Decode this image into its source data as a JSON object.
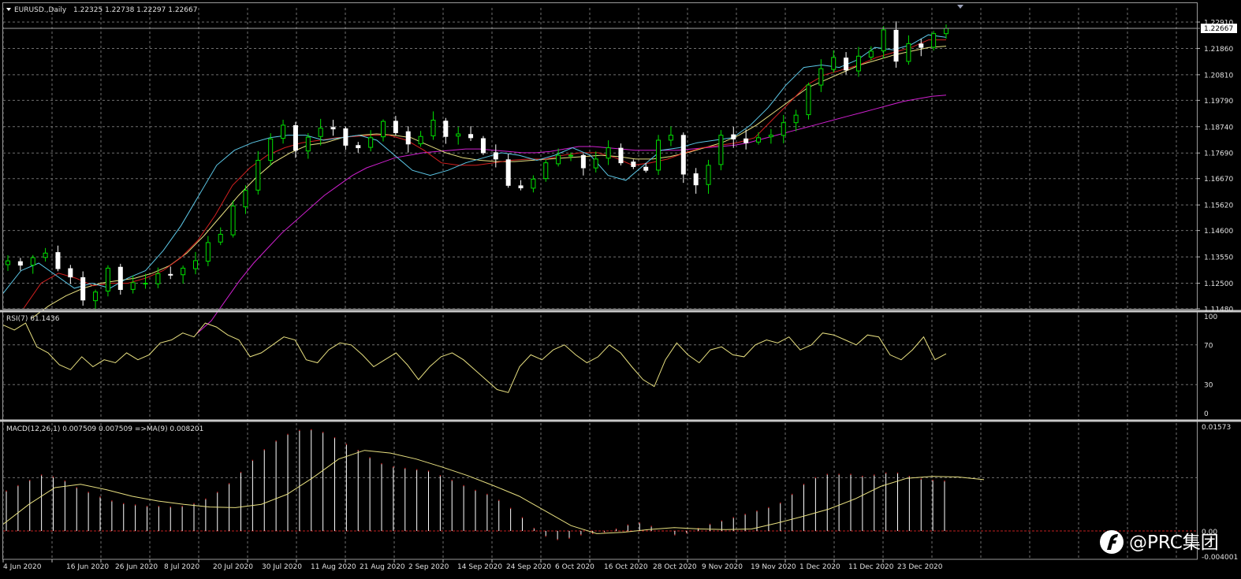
{
  "header": {
    "symbol": "EURUSD.,Daily",
    "ohlc": "1.22325 1.22738 1.22297 1.22667"
  },
  "price_tag": "1.22667",
  "rsi_label": "RSI(7) 61.1436",
  "macd_label": "MACD(12,26,1) 0.007509 0.007509 =>MA(9) 0.008201",
  "watermark": "@PRC集团",
  "colors": {
    "background": "#000000",
    "grid": "#6f6f6f",
    "bull_candle": "#00e000",
    "bear_candle": "#ffffff",
    "ma_fast": "#5cc8e8",
    "ma_mid": "#d42020",
    "ma_slow": "#e8e080",
    "ma_long": "#d020d0",
    "rsi_line": "#e8e080",
    "macd_hist": "#ffffff",
    "macd_signal": "#e8e080",
    "zero_line": "#c02020"
  },
  "chart_data": [
    {
      "type": "candlestick",
      "title": "EURUSD.,Daily",
      "ylim": [
        1.1148,
        1.2291
      ],
      "y_ticks": [
        "1.22910",
        "1.21860",
        "1.20810",
        "1.19790",
        "1.18740",
        "1.17690",
        "1.16670",
        "1.15620",
        "1.14600",
        "1.13550",
        "1.12500",
        "1.11480"
      ],
      "x_ticks": [
        "4 Jun 2020",
        "16 Jun 2020",
        "26 Jun 2020",
        "8 Jul 2020",
        "20 Jul 2020",
        "30 Jul 2020",
        "11 Aug 2020",
        "21 Aug 2020",
        "2 Sep 2020",
        "14 Sep 2020",
        "24 Sep 2020",
        "6 Oct 2020",
        "16 Oct 2020",
        "28 Oct 2020",
        "9 Nov 2020",
        "19 Nov 2020",
        "1 Dec 2020",
        "11 Dec 2020",
        "23 Dec 2020"
      ],
      "close_anchors": [
        1.1339,
        1.1322,
        1.1352,
        1.137,
        1.1308,
        1.1275,
        1.1183,
        1.1215,
        1.131,
        1.1225,
        1.1252,
        1.125,
        1.1288,
        1.1285,
        1.131,
        1.134,
        1.1412,
        1.1445,
        1.1558,
        1.162,
        1.174,
        1.1825,
        1.188,
        1.178,
        1.1832,
        1.1868,
        1.1865,
        1.18,
        1.179,
        1.183,
        1.1895,
        1.185,
        1.1805,
        1.1835,
        1.19,
        1.1835,
        1.1845,
        1.183,
        1.177,
        1.1745,
        1.164,
        1.163,
        1.1665,
        1.173,
        1.176,
        1.176,
        1.171,
        1.1745,
        1.179,
        1.173,
        1.1715,
        1.17,
        1.182,
        1.184,
        1.1685,
        1.1642,
        1.172,
        1.184,
        1.1825,
        1.181,
        1.183,
        1.184,
        1.189,
        1.192,
        1.204,
        1.2105,
        1.215,
        1.21,
        1.2155,
        1.2175,
        1.226,
        1.2135,
        1.2205,
        1.219,
        1.2245,
        1.2266
      ],
      "overlay_lines": [
        {
          "color_key": "ma_fast",
          "values": [
            1.121,
            1.13,
            1.133,
            1.128,
            1.123,
            1.125,
            1.123,
            1.127,
            1.13,
            1.138,
            1.148,
            1.16,
            1.172,
            1.178,
            1.181,
            1.183,
            1.184,
            1.184,
            1.182,
            1.183,
            1.184,
            1.182,
            1.176,
            1.17,
            1.168,
            1.17,
            1.173,
            1.175,
            1.177,
            1.176,
            1.174,
            1.176,
            1.179,
            1.176,
            1.168,
            1.166,
            1.172,
            1.178,
            1.179,
            1.181,
            1.182,
            1.183,
            1.188,
            1.195,
            1.204,
            1.211,
            1.212,
            1.211,
            1.214,
            1.219,
            1.218,
            1.22,
            1.224,
            1.223
          ]
        },
        {
          "color_key": "ma_mid",
          "values": [
            1.115,
            1.125,
            1.129,
            1.127,
            1.124,
            1.125,
            1.125,
            1.127,
            1.13,
            1.135,
            1.142,
            1.152,
            1.164,
            1.171,
            1.176,
            1.179,
            1.181,
            1.182,
            1.183,
            1.1835,
            1.184,
            1.184,
            1.182,
            1.178,
            1.173,
            1.172,
            1.172,
            1.173,
            1.174,
            1.1745,
            1.1745,
            1.176,
            1.177,
            1.177,
            1.175,
            1.172,
            1.173,
            1.1745,
            1.177,
            1.179,
            1.18,
            1.181,
            1.183,
            1.19,
            1.197,
            1.204,
            1.208,
            1.21,
            1.212,
            1.215,
            1.217,
            1.219,
            1.222,
            1.222
          ]
        },
        {
          "color_key": "ma_slow",
          "values": [
            1.111,
            1.116,
            1.12,
            1.123,
            1.125,
            1.126,
            1.127,
            1.129,
            1.132,
            1.137,
            1.144,
            1.152,
            1.16,
            1.167,
            1.173,
            1.177,
            1.18,
            1.181,
            1.183,
            1.184,
            1.1845,
            1.184,
            1.183,
            1.18,
            1.177,
            1.175,
            1.174,
            1.1735,
            1.1735,
            1.174,
            1.1745,
            1.175,
            1.1755,
            1.176,
            1.1755,
            1.1745,
            1.1745,
            1.1755,
            1.177,
            1.179,
            1.181,
            1.184,
            1.188,
            1.193,
            1.198,
            1.203,
            1.206,
            1.209,
            1.212,
            1.214,
            1.216,
            1.2175,
            1.219,
            1.2195
          ]
        },
        {
          "color_key": "ma_long",
          "values": [
            1.105,
            1.11,
            1.118,
            1.126,
            1.133,
            1.139,
            1.145,
            1.15,
            1.155,
            1.16,
            1.164,
            1.168,
            1.171,
            1.173,
            1.175,
            1.176,
            1.177,
            1.1775,
            1.178,
            1.1785,
            1.1785,
            1.178,
            1.1775,
            1.177,
            1.177,
            1.1775,
            1.1785,
            1.1795,
            1.1795,
            1.179,
            1.1785,
            1.178,
            1.178,
            1.178,
            1.178,
            1.1785,
            1.179,
            1.1795,
            1.18,
            1.181,
            1.1825,
            1.184,
            1.1855,
            1.187,
            1.1885,
            1.19,
            1.1915,
            1.193,
            1.1945,
            1.196,
            1.1975,
            1.1985,
            1.1995,
            1.2
          ]
        }
      ]
    },
    {
      "type": "line",
      "title": "RSI(7) 61.1436",
      "ylim": [
        0,
        100
      ],
      "y_ticks": [
        "100",
        "70",
        "30",
        "0"
      ],
      "values": [
        90,
        85,
        92,
        68,
        62,
        50,
        45,
        58,
        48,
        55,
        52,
        62,
        55,
        60,
        72,
        75,
        82,
        78,
        92,
        88,
        80,
        75,
        58,
        62,
        70,
        78,
        75,
        55,
        52,
        65,
        72,
        70,
        60,
        48,
        55,
        62,
        50,
        35,
        48,
        58,
        62,
        55,
        45,
        35,
        25,
        22,
        48,
        60,
        55,
        65,
        70,
        60,
        52,
        58,
        70,
        62,
        48,
        35,
        28,
        55,
        72,
        60,
        52,
        65,
        68,
        60,
        58,
        70,
        75,
        72,
        78,
        65,
        70,
        82,
        80,
        75,
        70,
        80,
        78,
        60,
        55,
        65,
        78,
        55,
        61
      ]
    },
    {
      "type": "bar",
      "title": "MACD(12,26,1) 0.007509 0.007509 =>MA(9) 0.008201",
      "ylim": [
        -0.004001,
        0.01573
      ],
      "y_ticks": [
        "0.01573",
        "0.00",
        "-0.004001"
      ],
      "series": [
        {
          "name": "MACD(12,26,1)",
          "values": [
            0.006,
            0.0068,
            0.0076,
            0.0084,
            0.0081,
            0.0075,
            0.0065,
            0.0058,
            0.0051,
            0.0045,
            0.0041,
            0.0039,
            0.0037,
            0.0037,
            0.0036,
            0.0037,
            0.0041,
            0.0048,
            0.0058,
            0.0071,
            0.0088,
            0.0106,
            0.0122,
            0.0135,
            0.0145,
            0.0151,
            0.0152,
            0.0148,
            0.014,
            0.013,
            0.0121,
            0.011,
            0.0101,
            0.0096,
            0.0094,
            0.0092,
            0.009,
            0.0083,
            0.0076,
            0.0068,
            0.0061,
            0.0055,
            0.0046,
            0.0034,
            0.002,
            0.0004,
            -0.0008,
            -0.0013,
            -0.0011,
            -0.0006,
            -0.0004,
            -0.0002,
            0.0003,
            0.0009,
            0.0012,
            0.0007,
            0.0,
            -0.0006,
            -0.0003,
            0.0004,
            0.001,
            0.0015,
            0.002,
            0.0025,
            0.003,
            0.0035,
            0.0042,
            0.0055,
            0.007,
            0.008,
            0.0085,
            0.0085,
            0.0085,
            0.0082,
            0.0084,
            0.0087,
            0.0087,
            0.0082,
            0.0078,
            0.0076,
            0.0075
          ]
        },
        {
          "name": "MA(9)",
          "values": [
            0.001,
            0.004,
            0.0065,
            0.007,
            0.0062,
            0.0052,
            0.0045,
            0.004,
            0.0036,
            0.0035,
            0.004,
            0.0055,
            0.008,
            0.0108,
            0.0121,
            0.0117,
            0.0108,
            0.0096,
            0.0083,
            0.0068,
            0.0052,
            0.003,
            0.0008,
            -0.0004,
            -0.0002,
            0.0002,
            0.0005,
            0.0003,
            0.0002,
            0.0003,
            0.0012,
            0.0022,
            0.0033,
            0.0048,
            0.0067,
            0.0079,
            0.0082,
            0.0081,
            0.0077
          ]
        }
      ]
    }
  ]
}
